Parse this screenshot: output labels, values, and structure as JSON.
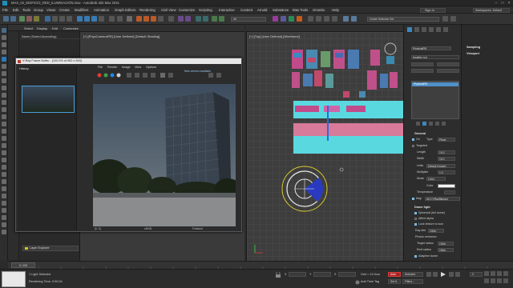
{
  "window": {
    "title": "MAX_02_EDIFICIO_RED_ILUMINACIÓN.max - Autodesk 3ds Max 2021"
  },
  "menu": {
    "items": [
      "File",
      "Edit",
      "Tools",
      "Group",
      "Views",
      "Create",
      "Modifiers",
      "Animation",
      "Graph Editors",
      "Rendering",
      "Civil View",
      "Customize",
      "Scripting",
      "Interactive",
      "Content",
      "Arnold",
      "Substance",
      "Max Tools",
      "Ornatrix",
      "Help"
    ],
    "sign_in": "Sign In",
    "workspace": "Workspaces: Default"
  },
  "toolbar": {
    "selection_filter": "All",
    "create_selection_set": "Create Selection Set"
  },
  "explorer": {
    "tabs": [
      "Select",
      "Display",
      "Edit",
      "Customize"
    ],
    "header": "Name (Sorted Ascending)",
    "layer_explorer": "Layer Explorer"
  },
  "viewport_left": {
    "label": "[+] [PhysCameraRR] [User Defined] [Default Shading]"
  },
  "viewport_right": {
    "label": "[+] [Top] [User Defined] [Wireframe]"
  },
  "vfb": {
    "title": "V-Ray Frame Buffer - [100.0% of 900 x 900]",
    "menu": [
      "File",
      "Render",
      "Image",
      "View",
      "Options"
    ],
    "update_notice": "New version available",
    "history": "History",
    "status_left": "[0, 0]",
    "status_mid": "sRGB",
    "status_right": "Finished"
  },
  "command_panel": {
    "object_name": "PhysicalRR",
    "modifier_list": "Modifier List",
    "stack_item": "PhysicalRR",
    "sections": {
      "sampling": "Sampling",
      "viewport": "Viewport",
      "general": "General"
    },
    "general": {
      "on_label": "On",
      "type_label": "Type",
      "type_value": "Plane",
      "targeted_label": "Targeted",
      "length_label": "Length",
      "length_value": "10.0",
      "width_label": "Width",
      "width_value": "10.0",
      "units_label": "Units",
      "units_value": "Default (image)",
      "multiplier_label": "Multiplier",
      "multiplier_value": "1.0",
      "mode_label": "Mode",
      "mode_value": "Color",
      "color_label": "Color",
      "temperature_label": "Temperature",
      "texture_label": "Map",
      "texture_value": "#12 (VRayBitmap)"
    },
    "dome": {
      "title": "Dome light",
      "spherical": "Spherical (full dome)",
      "affect_alpha": "Affect alpha",
      "lock_texture": "Lock texture to icon",
      "ray_dist_label": "Ray dist",
      "ray_dist_value": "100m",
      "photon_title": "Photon emission",
      "target_radius_label": "Target radius",
      "target_radius_value": "100m",
      "emit_radius_label": "Emit radius",
      "emit_radius_value": "150m",
      "adaptive": "Adaptive dome"
    }
  },
  "status": {
    "selected": "1 Light Selected",
    "render_time": "Rendering Time: 0:00:04",
    "x": "X",
    "y": "Y",
    "z": "Z",
    "grid": "Grid = 10.0cm",
    "add_time_tag": "Add Time Tag",
    "auto": "Auto",
    "selected_btn": "Selected",
    "set_k": "Set K.",
    "filters": "Filters...",
    "frame": "0",
    "timeline_range": "0 / 100"
  }
}
